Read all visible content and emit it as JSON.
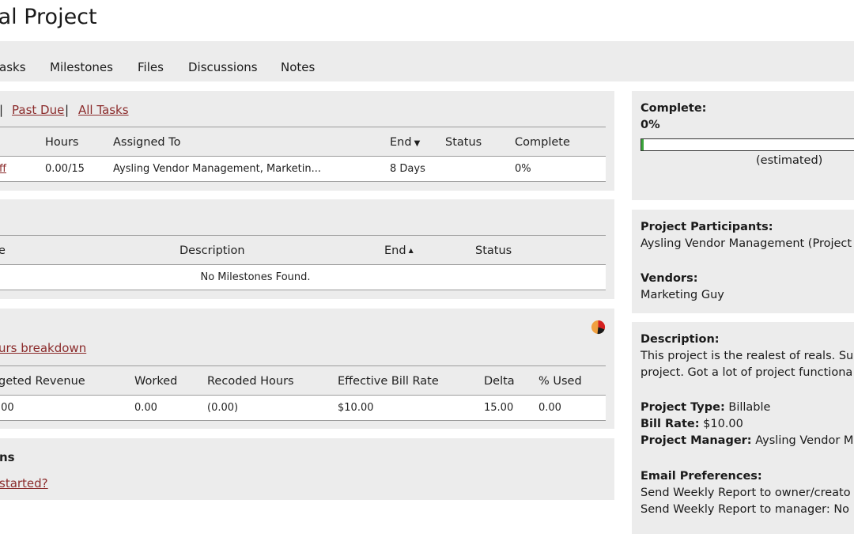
{
  "page": {
    "title": "eal Project"
  },
  "tabs": [
    "asks",
    "Milestones",
    "Files",
    "Discussions",
    "Notes"
  ],
  "tasks": {
    "filters": {
      "past_due": "Past Due",
      "sep1": "|",
      "sep2": "|",
      "all_tasks": "All Tasks"
    },
    "columns": {
      "hours": "Hours",
      "assigned_to": "Assigned To",
      "end": "End",
      "status": "Status",
      "complete": "Complete"
    },
    "rows": [
      {
        "name": "ff",
        "hours": "0.00/15",
        "assigned_to": "Aysling Vendor Management, Marketin...",
        "end": "8 Days",
        "status": "",
        "complete": "0%"
      }
    ]
  },
  "milestones": {
    "columns": {
      "name": "e",
      "description": "Description",
      "end": "End",
      "status": "Status"
    },
    "empty_message": "No Milestones Found."
  },
  "budget": {
    "hours_breakdown_link": "urs breakdown",
    "columns": {
      "revenue": "geted Revenue",
      "worked": "Worked",
      "recoded": "Recoded Hours",
      "rate": "Effective Bill Rate",
      "delta": "Delta",
      "used": "% Used"
    },
    "rows": [
      {
        "revenue": ".00",
        "worked": "0.00",
        "recoded": "(0.00)",
        "rate": "$10.00",
        "delta": "15.00",
        "used": "0.00"
      }
    ]
  },
  "questions": {
    "heading": "ns",
    "link": "started?"
  },
  "sidebar": {
    "complete_label": "Complete:",
    "complete_value": "0%",
    "progress_fraction": 0.0,
    "estimated": "(estimated)",
    "participants_label": "Project Participants:",
    "participants_value": "Aysling Vendor Management (Project",
    "vendors_label": "Vendors:",
    "vendors_value": "Marketing Guy",
    "description_label": "Description:",
    "description_line1": "This project is the realest of reals. Su",
    "description_line2": "project. Got a lot of project functiona",
    "project_type_label": "Project Type:",
    "project_type_value": "Billable",
    "bill_rate_label": "Bill Rate:",
    "bill_rate_value": "$10.00",
    "manager_label": "Project Manager:",
    "manager_value": "Aysling Vendor Ma",
    "email_label": "Email Preferences:",
    "email_line1": "Send Weekly Report to owner/creato",
    "email_line2": "Send Weekly Report to manager: No"
  },
  "colors": {
    "link": "#8b2b2b",
    "panel": "#ececec",
    "progress": "#3aa53a"
  },
  "icons": {
    "pie": "pie-chart-icon",
    "sort_desc": "sort-desc-icon",
    "sort_asc": "sort-asc-icon"
  }
}
